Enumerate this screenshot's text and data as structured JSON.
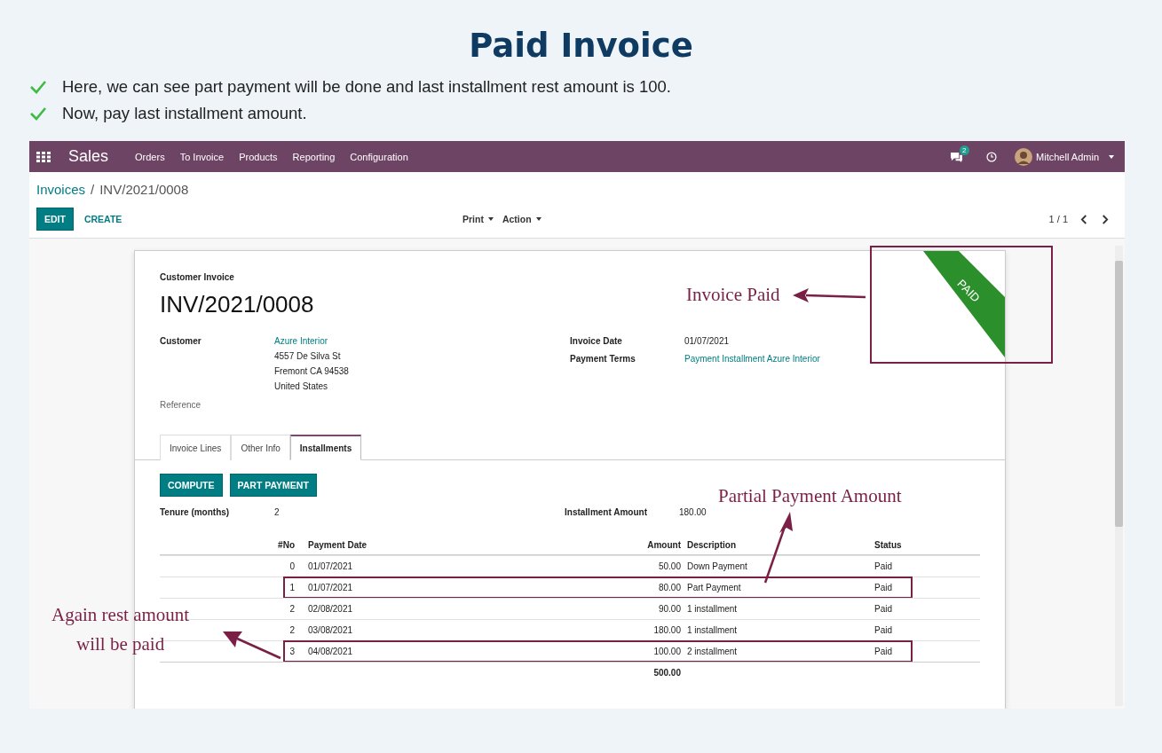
{
  "title": "Paid Invoice",
  "bullets": [
    "Here, we can see part payment will be done and last installment rest amount is 100.",
    "Now, pay last installment amount."
  ],
  "navbar": {
    "brand": "Sales",
    "menu": [
      "Orders",
      "To Invoice",
      "Products",
      "Reporting",
      "Configuration"
    ],
    "message_count": "2",
    "user": "Mitchell Admin"
  },
  "breadcrumb": {
    "parent": "Invoices",
    "separator": "/",
    "current": "INV/2021/0008"
  },
  "buttons": {
    "edit": "EDIT",
    "create": "CREATE"
  },
  "dropdowns": [
    "Print",
    "Action"
  ],
  "pager": "1 / 1",
  "invoice": {
    "ribbon": "PAID",
    "doc_type": "Customer Invoice",
    "number": "INV/2021/0008",
    "customer_label": "Customer",
    "customer": "Azure Interior",
    "address": [
      "4557 De Silva St",
      "Fremont CA 94538",
      "United States"
    ],
    "reference_label": "Reference",
    "right_fields": [
      {
        "label": "Invoice Date",
        "value": "01/07/2021",
        "kind": "text"
      },
      {
        "label": "Payment Terms",
        "value": "Payment Installment Azure Interior",
        "kind": "link"
      }
    ]
  },
  "tabs": [
    {
      "label": "Invoice Lines",
      "selected": false
    },
    {
      "label": "Other Info",
      "selected": false
    },
    {
      "label": "Installments",
      "selected": true
    }
  ],
  "actions": [
    "COMPUTE",
    "PART PAYMENT"
  ],
  "tenure": {
    "label": "Tenure (months)",
    "value": "2"
  },
  "installment_amount": {
    "label": "Installment Amount",
    "value": "180.00"
  },
  "table": {
    "columns": [
      "#No",
      "Payment Date",
      "Amount",
      "Description",
      "Status"
    ],
    "rows": [
      {
        "no": "0",
        "date": "01/07/2021",
        "amount": "50.00",
        "description": "Down Payment",
        "status": "Paid",
        "highlighted": false
      },
      {
        "no": "1",
        "date": "01/07/2021",
        "amount": "80.00",
        "description": "Part Payment",
        "status": "Paid",
        "highlighted": true
      },
      {
        "no": "2",
        "date": "02/08/2021",
        "amount": "90.00",
        "description": "1 installment",
        "status": "Paid",
        "highlighted": false
      },
      {
        "no": "2",
        "date": "03/08/2021",
        "amount": "180.00",
        "description": "1 installment",
        "status": "Paid",
        "highlighted": false
      },
      {
        "no": "3",
        "date": "04/08/2021",
        "amount": "100.00",
        "description": "2 installment",
        "status": "Paid",
        "highlighted": true
      }
    ],
    "total": "500.00"
  },
  "annotations": {
    "invoice_paid": "Invoice Paid",
    "partial": "Partial Payment Amount",
    "rest": [
      "Again rest amount",
      "will be paid"
    ]
  }
}
